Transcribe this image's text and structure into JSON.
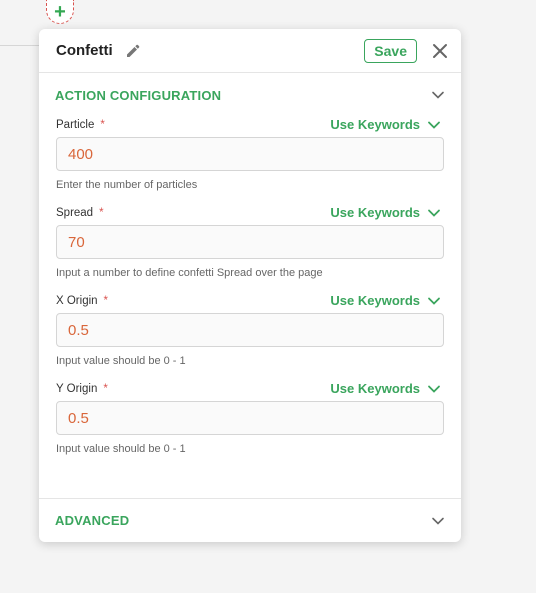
{
  "add_node": {
    "symbol": "+"
  },
  "panel": {
    "title": "Confetti",
    "save_label": "Save",
    "icons": {
      "edit": "pencil-icon",
      "close": "close-icon"
    }
  },
  "action_config": {
    "title": "ACTION CONFIGURATION",
    "fields": [
      {
        "label": "Particle",
        "required": "*",
        "keywords": "Use Keywords",
        "value": "400",
        "hint": "Enter the number of particles"
      },
      {
        "label": "Spread",
        "required": "*",
        "keywords": "Use Keywords",
        "value": "70",
        "hint": "Input a number to define confetti Spread over the page"
      },
      {
        "label": "X Origin",
        "required": "*",
        "keywords": "Use Keywords",
        "value": "0.5",
        "hint": "Input value should be 0 - 1"
      },
      {
        "label": "Y Origin",
        "required": "*",
        "keywords": "Use Keywords",
        "value": "0.5",
        "hint": "Input value should be 0 - 1"
      }
    ]
  },
  "advanced": {
    "title": "ADVANCED"
  },
  "colors": {
    "accent": "#3aa55d",
    "value": "#d9663a",
    "required": "#d9534f"
  }
}
